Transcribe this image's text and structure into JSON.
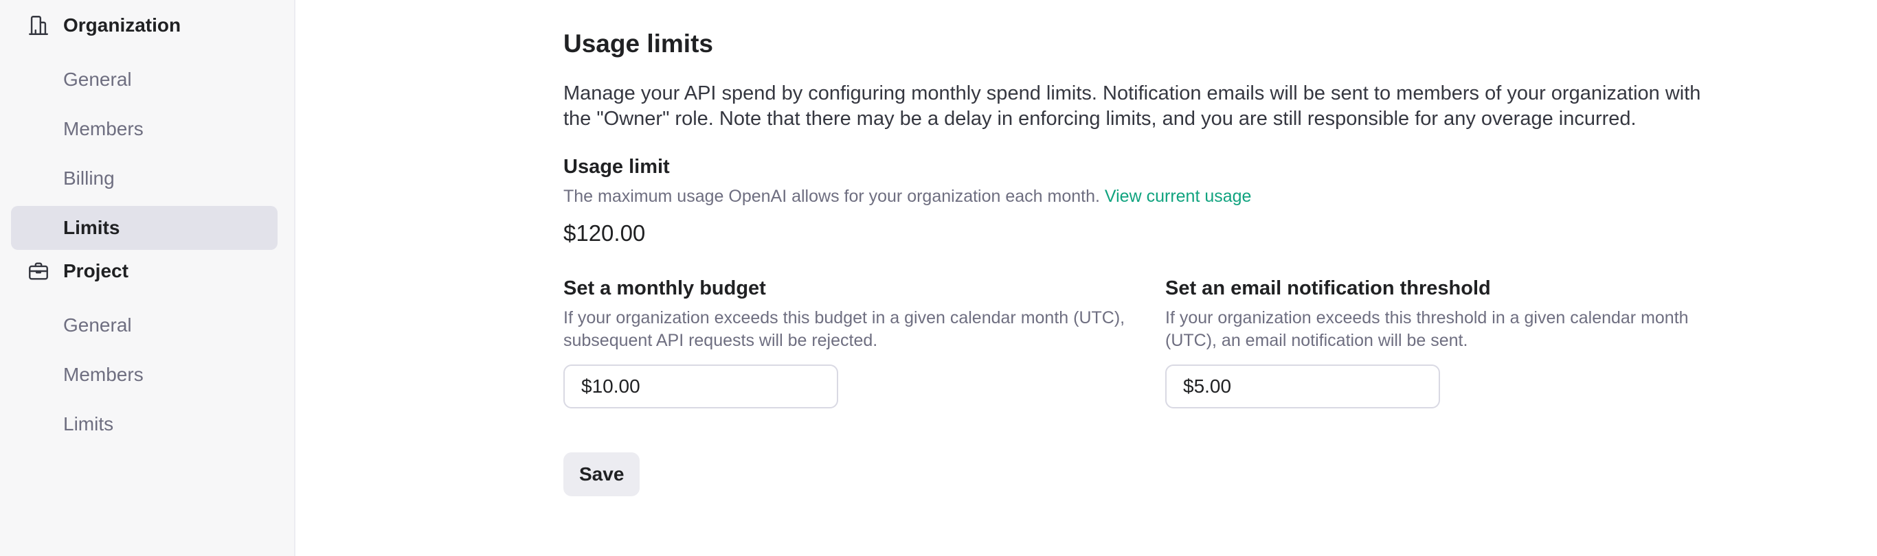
{
  "sidebar": {
    "organization": {
      "title": "Organization",
      "icon": "building-icon",
      "items": [
        {
          "label": "General"
        },
        {
          "label": "Members"
        },
        {
          "label": "Billing"
        },
        {
          "label": "Limits",
          "active": true
        }
      ]
    },
    "project": {
      "title": "Project",
      "icon": "briefcase-icon",
      "items": [
        {
          "label": "General"
        },
        {
          "label": "Members"
        },
        {
          "label": "Limits"
        }
      ]
    }
  },
  "main": {
    "title": "Usage limits",
    "description": "Manage your API spend by configuring monthly spend limits. Notification emails will be sent to members of your organization with the \"Owner\" role. Note that there may be a delay in enforcing limits, and you are still responsible for any overage incurred.",
    "usage_limit": {
      "title": "Usage limit",
      "subtitle": "The maximum usage OpenAI allows for your organization each month.",
      "link": "View current usage",
      "value": "$120.00"
    },
    "monthly_budget": {
      "title": "Set a monthly budget",
      "subtitle": "If your organization exceeds this budget in a given calendar month (UTC), subsequent API requests will be rejected.",
      "value": "$10.00"
    },
    "notification_threshold": {
      "title": "Set an email notification threshold",
      "subtitle": "If your organization exceeds this threshold in a given calendar month (UTC), an email notification will be sent.",
      "value": "$5.00"
    },
    "save_label": "Save"
  },
  "colors": {
    "accent_link": "#10a37f",
    "sidebar_bg": "#f7f7f8",
    "active_item_bg": "#e2e2ea"
  }
}
